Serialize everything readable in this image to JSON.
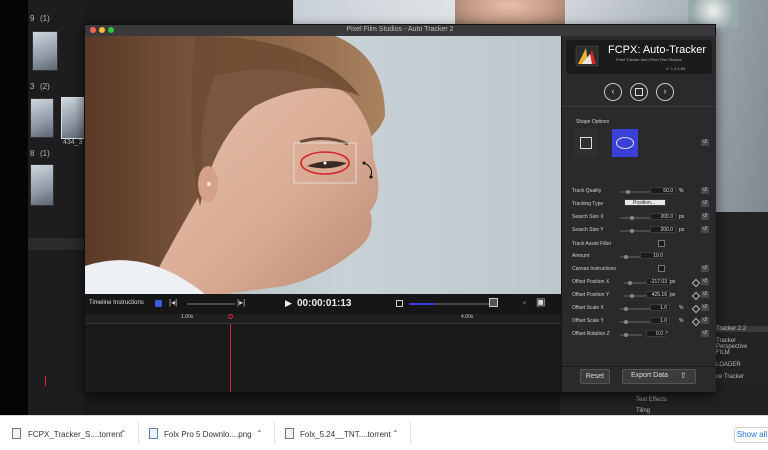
{
  "background": {
    "events": [
      "9",
      "(1)",
      "3",
      "(2)",
      "8",
      "(1)"
    ],
    "clip_label": "434_3",
    "effects_list": [
      "Tracker 2.2",
      "Tracker Perspective",
      "FILM",
      "LOADER",
      "ce Tracker"
    ],
    "bottom_list": [
      "Text Effects",
      "Tiling"
    ]
  },
  "window": {
    "title": "Pixel Film Studios - Auto Tracker 2",
    "timeline_instructions": "Timeline Instructions",
    "timecode": "00:00:01:13",
    "ruler_marks": [
      "1.00s",
      "4.00s"
    ]
  },
  "plugin": {
    "title": "FCPX: Auto-Tracker",
    "subtitle": "Point Tracker from Pixel Film Studios",
    "version": "V: 1.3.4.89",
    "shape_options": "Shape Options",
    "params": [
      {
        "label": "Track Quality",
        "value": "50.0",
        "unit": "%"
      },
      {
        "label": "Tracking Type",
        "value": "Position..."
      },
      {
        "label": "Search Size X",
        "value": "200.0",
        "unit": "px"
      },
      {
        "label": "Search Size Y",
        "value": "200.0",
        "unit": "px"
      },
      {
        "label": "Track Assist Filter"
      },
      {
        "label": "Amount",
        "value": "10.0"
      },
      {
        "label": "Canvas Instructions"
      },
      {
        "label": "Offset Position X",
        "value": "-217.03",
        "unit": "px"
      },
      {
        "label": "Offset Position Y",
        "value": "425.16",
        "unit": "px"
      },
      {
        "label": "Offset Scale X",
        "value": "1.0",
        "unit": "%"
      },
      {
        "label": "Offset Scale Y",
        "value": "1.0",
        "unit": "%"
      },
      {
        "label": "Offset Rotation Z",
        "value": "0.0",
        "unit": "°"
      }
    ],
    "reset_label": "Reset",
    "export_label": "Export Data"
  },
  "downloads": {
    "items": [
      {
        "name": "FCPX_Tracker_S....torrent"
      },
      {
        "name": "Folx Pro 5 Downlo....png"
      },
      {
        "name": "Folx_5.24__TNT....torrent"
      }
    ],
    "show_all": "Show all"
  },
  "colors": {
    "accent": "#3a3fd8",
    "ellipse": "#d8242a"
  }
}
